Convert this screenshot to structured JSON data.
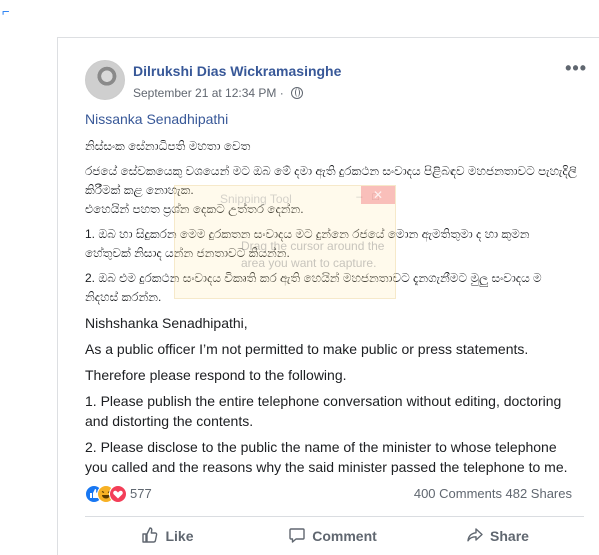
{
  "post": {
    "author": "Dilrukshi Dias Wickramasinghe",
    "timestamp": "September 21 at 12:34 PM",
    "meta_separator": "·",
    "more_label": "•••",
    "mention": "Nissanka Senadhipathi",
    "sinhala": {
      "salutation": "නිස්සංක සේනාධිපති මහතා වෙත",
      "para1": "රජයේ සේවකයෙකු වශයෙන් මට ඔබ මේ දමා ඇති දුරකථන සංවාදය පිළිබඳව මහජනතාවට පැහැදිලි කිරීමක් කළ නොහැක.",
      "para1b": "එහෙයින් පහත ප්‍රශ්න දෙකට උත්තර දෙන්න.",
      "item1": "1. ඔබ හා සිදුකරන මෙම දුරකතන සංවාදය මට දුන්නෙ රජයේ මොන ඇමතිතුමා ද හා කුමන හේතුවක් නිසාද යන්න ජනතාවට කියන්න.",
      "item2": "2. ඔබ එම දුරකථන සංවාදය විකෘති කර ඇති හෙයින් මහජනතාවට දැනගැනීමට මුලු සංවාදය ම නිදහස් කරන්න."
    },
    "english": {
      "salutation": "Nishshanka Senadhipathi,",
      "para1": "As a public officer I’m not permitted to make public or press statements.",
      "para2": "Therefore please respond to the following.",
      "item1": "1. Please publish the entire telephone conversation without editing, doctoring and distorting the contents.",
      "item2": "2. Please disclose to the public the name of the minister to whose telephone you called and the reasons why the said minister passed the telephone to me."
    }
  },
  "overlay": {
    "title": "Snipping Tool",
    "message": "Drag the cursor around the area you want to capture."
  },
  "stats": {
    "reaction_count": "577",
    "comments": "400 Comments",
    "shares": "482 Shares"
  },
  "actions": {
    "like": "Like",
    "comment": "Comment",
    "share": "Share"
  },
  "colors": {
    "link": "#385898",
    "like_blue": "#1877f2",
    "haha_yellow": "#f7b125",
    "love_red": "#f33e58"
  }
}
